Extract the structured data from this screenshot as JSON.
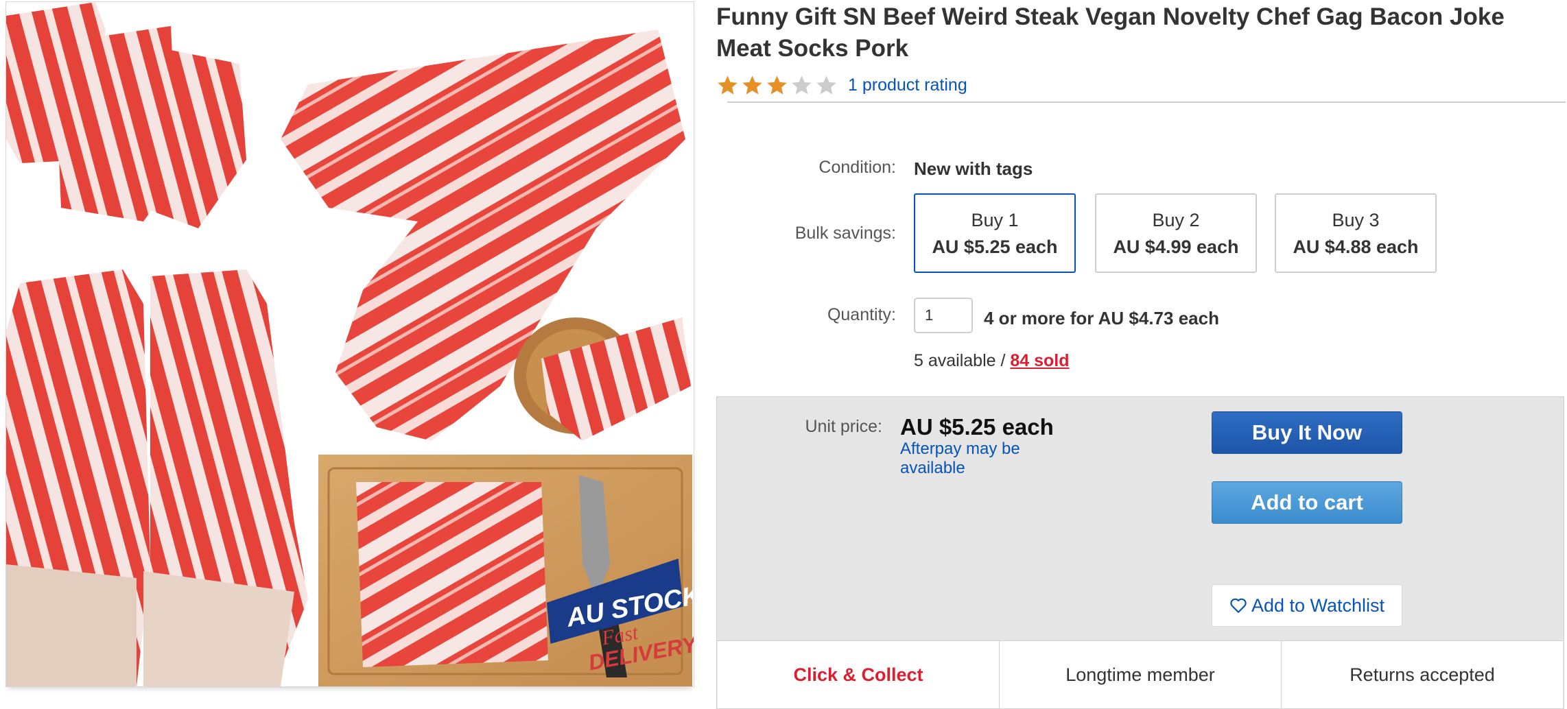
{
  "product": {
    "title": "Funny Gift SN Beef Weird Steak Vegan Novelty Chef Gag Bacon Joke Meat Socks Pork",
    "rating": {
      "value": 3,
      "max": 5,
      "link_text": "1 product rating"
    },
    "image": {
      "badge_line1": "AU STOCK",
      "badge_line2": "Fast",
      "badge_line3": "DELIVERY"
    }
  },
  "details": {
    "condition_label": "Condition:",
    "condition_value": "New with tags",
    "bulk_label": "Bulk savings:",
    "bulk_options": [
      {
        "qty": "Buy 1",
        "price": "AU $5.25 each",
        "selected": true
      },
      {
        "qty": "Buy 2",
        "price": "AU $4.99 each",
        "selected": false
      },
      {
        "qty": "Buy 3",
        "price": "AU $4.88 each",
        "selected": false
      }
    ],
    "quantity_label": "Quantity:",
    "quantity_value": "1",
    "quantity_offer": "4 or more for AU $4.73 each",
    "available_text": "5 available / ",
    "sold_text": "84 sold"
  },
  "buy_box": {
    "unit_price_label": "Unit price:",
    "unit_price": "AU $5.25 each",
    "afterpay": "Afterpay may be available",
    "buy_now": "Buy It Now",
    "add_to_cart": "Add to cart",
    "watchlist": "Add to Watchlist"
  },
  "features": [
    "Click & Collect",
    "Longtime member",
    "Returns accepted"
  ],
  "colors": {
    "link_blue": "#0654ba",
    "star_filled": "#e59127",
    "star_empty": "#cccccc",
    "accent_red": "#dd1e31",
    "buy_now_blue": "#1d55a8",
    "add_cart_blue": "#3a8bcd"
  }
}
